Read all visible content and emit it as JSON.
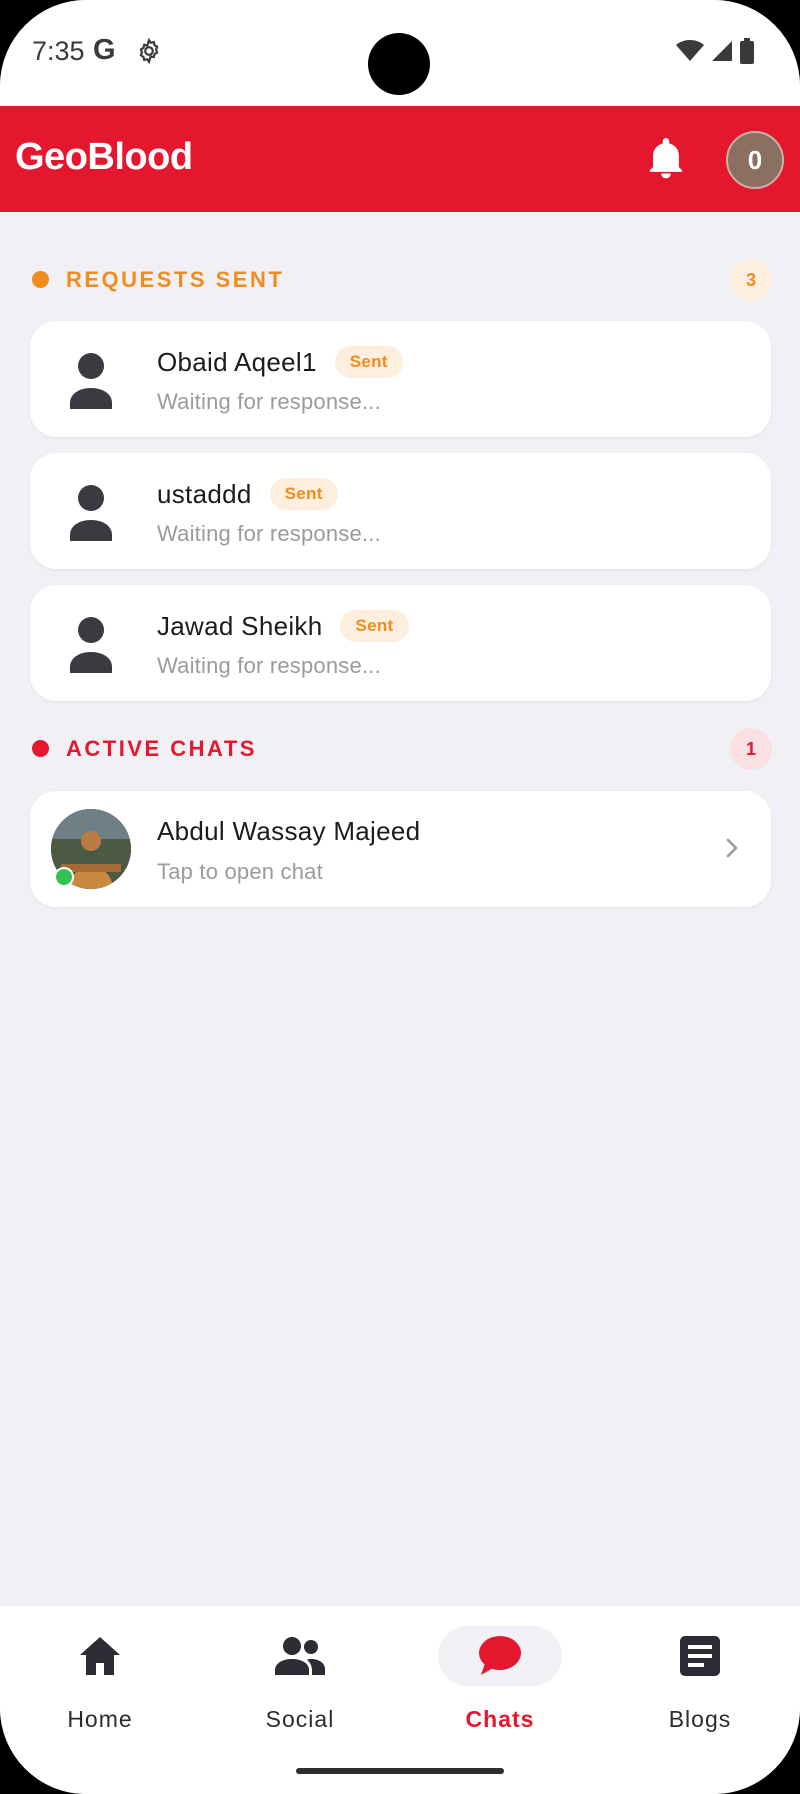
{
  "status_bar": {
    "time": "7:35",
    "g_icon": "G",
    "icons": [
      "settings-icon",
      "wifi-icon",
      "signal-icon",
      "battery-icon"
    ]
  },
  "app_bar": {
    "title": "GeoBlood",
    "notification_icon": "bell-icon",
    "profile_initial": "0"
  },
  "requests_sent": {
    "title": "REQUESTS SENT",
    "count": "3",
    "color": "#f28c1e",
    "items": [
      {
        "name": "Obaid Aqeel1",
        "badge": "Sent",
        "subtitle": "Waiting for response..."
      },
      {
        "name": "ustaddd",
        "badge": "Sent",
        "subtitle": "Waiting for response..."
      },
      {
        "name": "Jawad Sheikh",
        "badge": "Sent",
        "subtitle": "Waiting for response..."
      }
    ]
  },
  "active_chats": {
    "title": "ACTIVE CHATS",
    "count": "1",
    "color": "#e5172e",
    "items": [
      {
        "name": "Abdul Wassay Majeed",
        "subtitle": "Tap to open chat",
        "online": true
      }
    ]
  },
  "bottom_nav": {
    "items": [
      {
        "label": "Home",
        "icon": "home-icon"
      },
      {
        "label": "Social",
        "icon": "people-icon"
      },
      {
        "label": "Chats",
        "icon": "chat-icon",
        "active": true
      },
      {
        "label": "Blogs",
        "icon": "article-icon"
      }
    ]
  },
  "colors": {
    "brand": "#e5172e",
    "background": "#f0f0f5",
    "pending": "#f28c1e"
  }
}
